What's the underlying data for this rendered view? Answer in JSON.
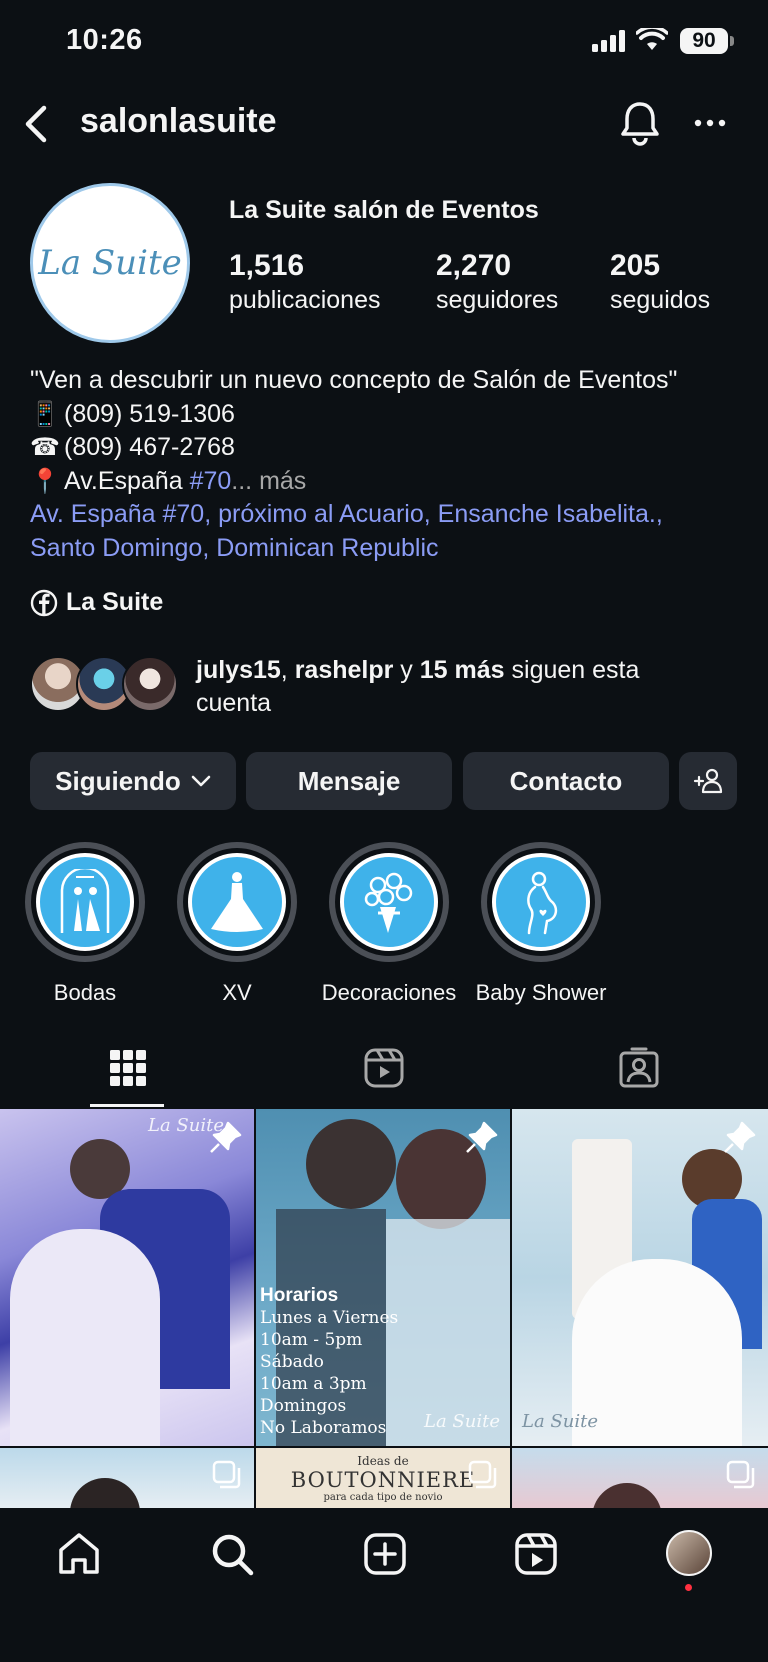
{
  "status_bar": {
    "time": "10:26",
    "battery": "90"
  },
  "header": {
    "username": "salonlasuite"
  },
  "profile": {
    "avatar_text": "La Suite",
    "full_name": "La Suite salón de Eventos",
    "stats": [
      {
        "value": "1,516",
        "label": "publicaciones"
      },
      {
        "value": "2,270",
        "label": "seguidores"
      },
      {
        "value": "205",
        "label": "seguidos"
      }
    ]
  },
  "bio": {
    "quote": "\"Ven a descubrir un nuevo concepto de Salón de Eventos\"",
    "phone_mobile": "(809) 519-1306",
    "phone_land": "(809) 467-2768",
    "address_prefix": "Av.España",
    "address_hash": "#70",
    "more": "... más",
    "location_line1": "Av. España #70,  próximo al Acuario, Ensanche Isabelita.,",
    "location_line2": "Santo Domingo, Dominican Republic"
  },
  "facebook_link": "La Suite",
  "followed_by": {
    "user1": "julys15",
    "sep": ", ",
    "user2": "rashelpr",
    "and": " y ",
    "others": "15 más",
    "rest": " siguen esta cuenta"
  },
  "buttons": {
    "following": "Siguiendo",
    "message": "Mensaje",
    "contact": "Contacto"
  },
  "highlights": [
    {
      "label": "Bodas"
    },
    {
      "label": "XV"
    },
    {
      "label": "Decoraciones"
    },
    {
      "label": "Baby Shower"
    }
  ],
  "posts": {
    "post2_overlay": {
      "title": "Horarios",
      "lines": [
        "Lunes a Viernes",
        "10am - 5pm",
        "Sábado",
        "10am a 3pm",
        "Domingos",
        "No Laboramos"
      ]
    },
    "watermark": "La Suite",
    "post5_top": "Ideas de",
    "post5_title": "BOUTONNIERE",
    "post5_sub": "para cada tipo de novio"
  },
  "colors": {
    "background": "#0c1014",
    "button_bg": "#262b33",
    "link": "#8b9cf5",
    "highlight_fill": "#3fb2ea",
    "notification_dot": "#ff3040"
  }
}
